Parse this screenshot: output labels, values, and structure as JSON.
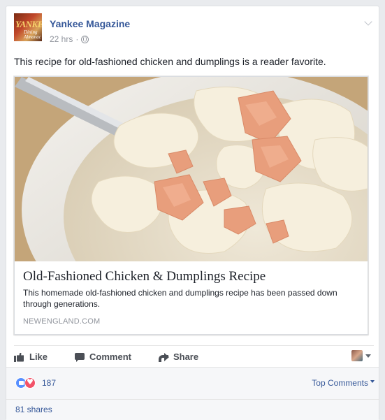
{
  "post": {
    "page_name": "Yankee Magazine",
    "time": "22 hrs",
    "separator": "·",
    "visibility_icon": "globe-icon",
    "text": "This recipe for old-fashioned chicken and dumplings is a reader favorite.",
    "avatar_logo_text": "YANKEE",
    "avatar_sub_text": "Dining Almanac"
  },
  "link": {
    "title": "Old-Fashioned Chicken & Dumplings Recipe",
    "description": "This homemade old-fashioned chicken and dumplings recipe has been passed down through generations.",
    "domain": "NEWENGLAND.COM",
    "image_subject": "bowl of chicken and dumplings with spoon"
  },
  "actions": {
    "like": "Like",
    "comment": "Comment",
    "share": "Share"
  },
  "reactions": {
    "count": "187",
    "types": [
      "like",
      "love"
    ],
    "sort_label": "Top Comments"
  },
  "shares": "81 shares",
  "colors": {
    "link_blue": "#365899",
    "like_blue": "#5890ff",
    "love_red": "#f25268",
    "muted_gray": "#90949c"
  }
}
